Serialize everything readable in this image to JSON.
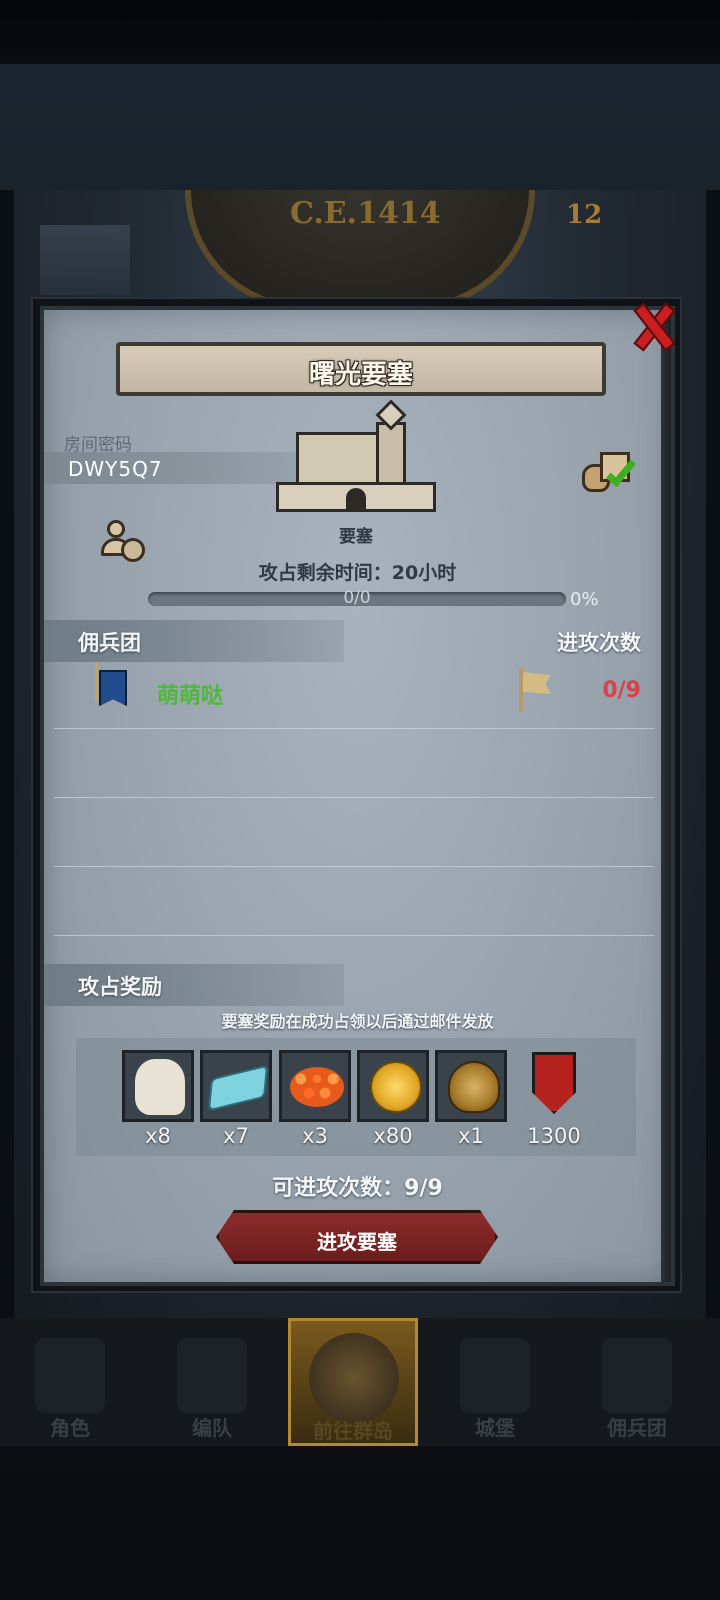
{
  "background": {
    "year": "C.E.1414",
    "clock_number": "12"
  },
  "dialog": {
    "title": "曙光要塞",
    "room": {
      "label": "房间密码",
      "code": "DWY5Q7"
    },
    "fortress_name": "要塞",
    "time_remaining": "攻占剩余时间：20小时",
    "progress": {
      "text": "0/0",
      "percent": "0%",
      "fraction": 0
    },
    "mercenary_header": "佣兵团",
    "attacks_header": "进攻次数",
    "guild": {
      "name": "萌萌哒",
      "attacks": "0/9"
    },
    "rewards": {
      "header": "攻占奖励",
      "note": "要塞奖励在成功占领以后通过邮件发放",
      "items": [
        {
          "icon": "horse-icon",
          "qty": "x8"
        },
        {
          "icon": "cloth-icon",
          "qty": "x7"
        },
        {
          "icon": "roe-icon",
          "qty": "x3"
        },
        {
          "icon": "gold-coin-icon",
          "qty": "x80"
        },
        {
          "icon": "helmet-icon",
          "qty": "x1"
        },
        {
          "icon": "shield-icon",
          "qty": "1300"
        }
      ]
    },
    "attacks_left": "可进攻次数：9/9",
    "attack_button": "进攻要塞"
  },
  "nav": {
    "items": [
      {
        "label": "角色"
      },
      {
        "label": "编队"
      },
      {
        "label": "前往群岛"
      },
      {
        "label": "城堡"
      },
      {
        "label": "佣兵团"
      }
    ],
    "active_index": 2
  },
  "colors": {
    "guild_name": "#4fb83a",
    "attack_count": "#d9414a",
    "button": "#8c2c2c",
    "close": "#c81f22"
  }
}
